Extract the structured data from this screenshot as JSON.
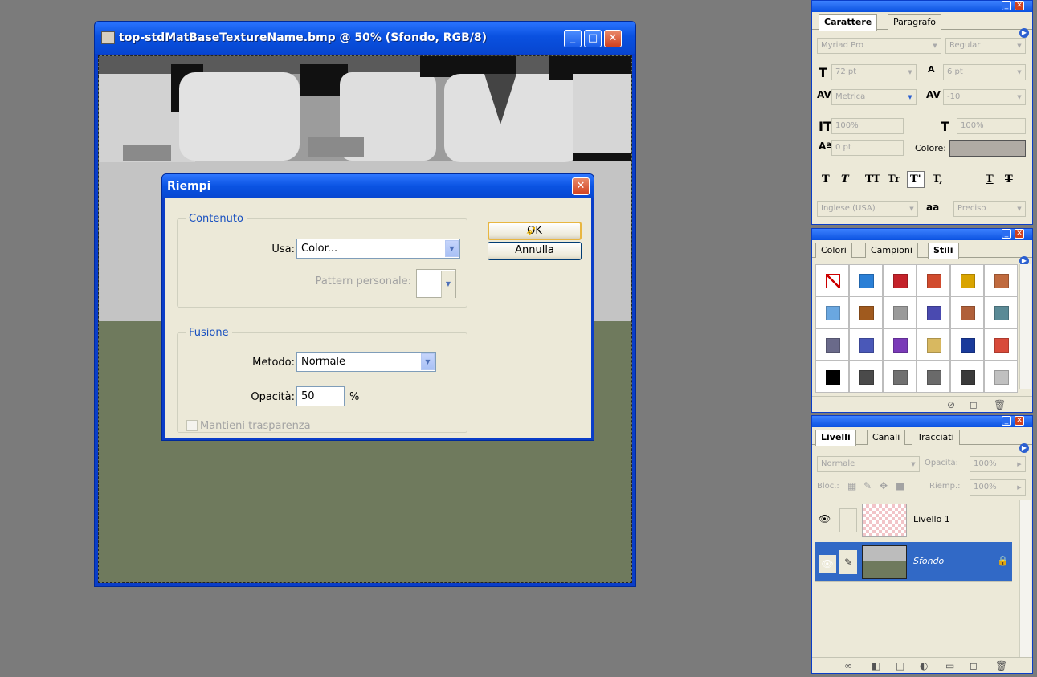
{
  "document": {
    "title": "top-stdMatBaseTextureName.bmp @ 50% (Sfondo, RGB/8)",
    "minimize": "_",
    "maximize": "□",
    "close": "✕"
  },
  "dialog": {
    "title": "Riempi",
    "close": "✕",
    "contenuto_legend": "Contenuto",
    "usa_label": "Usa:",
    "usa_value": "Color...",
    "pattern_label": "Pattern personale:",
    "fusione_legend": "Fusione",
    "metodo_label": "Metodo:",
    "metodo_value": "Normale",
    "opacita_label": "Opacità:",
    "opacita_value": "50",
    "opacita_unit": "%",
    "mantieni_label": "Mantieni trasparenza",
    "ok": "OK",
    "annulla": "Annulla"
  },
  "character_panel": {
    "tabs": [
      "Carattere",
      "Paragrafo"
    ],
    "font_family": "Myriad Pro",
    "font_style": "Regular",
    "size": "72 pt",
    "leading": "6 pt",
    "kerning": "Metrica",
    "tracking": "-10",
    "vscale": "100%",
    "hscale": "100%",
    "baseline": "0 pt",
    "colore_label": "Colore:",
    "color": "#b0aba4",
    "language": "Inglese (USA)",
    "aa_label": "a",
    "aa_value": "Preciso",
    "style_buttons": [
      "T",
      "T",
      "TT",
      "Tr",
      "T'",
      "T,",
      "T",
      "T"
    ]
  },
  "styles_panel": {
    "tabs": [
      "Colori",
      "Campioni",
      "Stili"
    ],
    "swatches": [
      "#ffffff",
      "#2a7fd6",
      "#c4222a",
      "#d14b2e",
      "#d9a400",
      "#c06a3e",
      "#6aa7e0",
      "#a05a1e",
      "#9a9a9a",
      "#4a4ab0",
      "#b0603a",
      "#5a8a96",
      "#6a6a8a",
      "#4a58b8",
      "#7a3ab8",
      "#d8b860",
      "#1a3a9a",
      "#d84a3a",
      "#000000",
      "#4a4a4a",
      "#707070",
      "#6a6a6a",
      "#3a3a3a",
      "#c0c0c0"
    ]
  },
  "layers_panel": {
    "tabs": [
      "Livelli",
      "Canali",
      "Tracciati"
    ],
    "blend_mode": "Normale",
    "opacity_label": "Opacità:",
    "opacity_value": "100%",
    "lock_label": "Bloc.:",
    "fill_label": "Riemp.:",
    "fill_value": "100%",
    "layers": [
      {
        "name": "Livello 1"
      },
      {
        "name": "Sfondo"
      }
    ]
  }
}
